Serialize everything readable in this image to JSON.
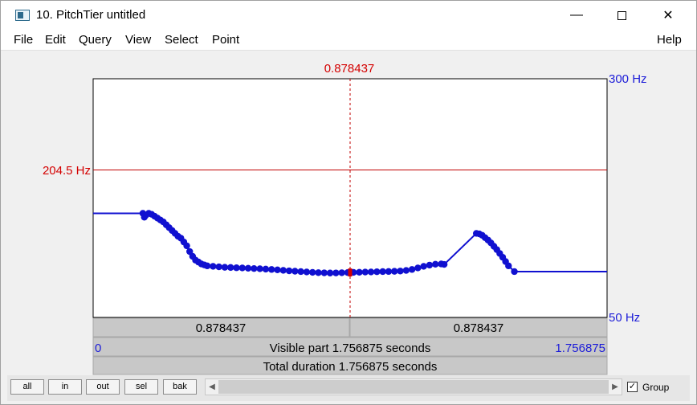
{
  "window": {
    "title": "10. PitchTier untitled"
  },
  "menu": {
    "file": "File",
    "edit": "Edit",
    "query": "Query",
    "view": "View",
    "select": "Select",
    "point": "Point",
    "help": "Help"
  },
  "editor": {
    "cursor_time": "0.878437",
    "top_hz": "300 Hz",
    "bottom_hz": "50 Hz",
    "cursor_hz": "204.5 Hz",
    "left_segment": "0.878437",
    "right_segment": "0.878437",
    "visible_start": "0",
    "visible_end": "1.756875",
    "visible_part": "Visible part 1.756875 seconds",
    "total_duration": "Total duration 1.756875 seconds"
  },
  "buttons": {
    "all": "all",
    "in": "in",
    "out": "out",
    "sel": "sel",
    "bak": "bak"
  },
  "group": {
    "label": "Group",
    "checked": true
  },
  "colors": {
    "pitch": "#1010d0",
    "cursor": "#d40000",
    "axis_label": "#1c1cd8"
  },
  "chart_data": {
    "type": "scatter",
    "xlim": [
      0,
      1.756875
    ],
    "ylim": [
      50,
      300
    ],
    "cursor_time": 0.878437,
    "cursor_value": 204.5,
    "points": [
      [
        0.17,
        159
      ],
      [
        0.175,
        155
      ],
      [
        0.18,
        157
      ],
      [
        0.19,
        159
      ],
      [
        0.2,
        158
      ],
      [
        0.21,
        156
      ],
      [
        0.22,
        154
      ],
      [
        0.23,
        152
      ],
      [
        0.24,
        150
      ],
      [
        0.25,
        147
      ],
      [
        0.26,
        144
      ],
      [
        0.27,
        141
      ],
      [
        0.28,
        138
      ],
      [
        0.29,
        135
      ],
      [
        0.3,
        133
      ],
      [
        0.31,
        129
      ],
      [
        0.32,
        125
      ],
      [
        0.33,
        119
      ],
      [
        0.34,
        114
      ],
      [
        0.35,
        110
      ],
      [
        0.36,
        108
      ],
      [
        0.37,
        106
      ],
      [
        0.38,
        105
      ],
      [
        0.39,
        104
      ],
      [
        0.41,
        103.5
      ],
      [
        0.43,
        103
      ],
      [
        0.45,
        102.5
      ],
      [
        0.47,
        102.3
      ],
      [
        0.49,
        102
      ],
      [
        0.51,
        101.8
      ],
      [
        0.53,
        101.5
      ],
      [
        0.55,
        101.2
      ],
      [
        0.57,
        101
      ],
      [
        0.59,
        100.6
      ],
      [
        0.61,
        100.2
      ],
      [
        0.63,
        99.8
      ],
      [
        0.65,
        99.3
      ],
      [
        0.67,
        98.8
      ],
      [
        0.69,
        98.4
      ],
      [
        0.71,
        98.0
      ],
      [
        0.73,
        97.6
      ],
      [
        0.75,
        97.2
      ],
      [
        0.77,
        96.9
      ],
      [
        0.79,
        96.7
      ],
      [
        0.81,
        96.5
      ],
      [
        0.83,
        96.6
      ],
      [
        0.85,
        96.8
      ],
      [
        0.87,
        97.0
      ],
      [
        0.89,
        97.2
      ],
      [
        0.91,
        97.3
      ],
      [
        0.93,
        97.5
      ],
      [
        0.95,
        97.6
      ],
      [
        0.97,
        97.8
      ],
      [
        0.99,
        98.0
      ],
      [
        1.01,
        98.1
      ],
      [
        1.03,
        98.3
      ],
      [
        1.05,
        98.6
      ],
      [
        1.07,
        99.2
      ],
      [
        1.09,
        100.2
      ],
      [
        1.11,
        101.8
      ],
      [
        1.13,
        103.5
      ],
      [
        1.15,
        104.8
      ],
      [
        1.17,
        105.7
      ],
      [
        1.19,
        106.0
      ],
      [
        1.2,
        105.5
      ],
      [
        1.31,
        138
      ],
      [
        1.32,
        137.5
      ],
      [
        1.33,
        136
      ],
      [
        1.34,
        133.5
      ],
      [
        1.35,
        131
      ],
      [
        1.36,
        128
      ],
      [
        1.37,
        124.5
      ],
      [
        1.38,
        121
      ],
      [
        1.39,
        117
      ],
      [
        1.4,
        113
      ],
      [
        1.41,
        108.5
      ],
      [
        1.42,
        104
      ],
      [
        1.44,
        98
      ]
    ],
    "cursor_point": [
      0.878437,
      97.1
    ],
    "hold_left": 159,
    "hold_right": 98
  }
}
